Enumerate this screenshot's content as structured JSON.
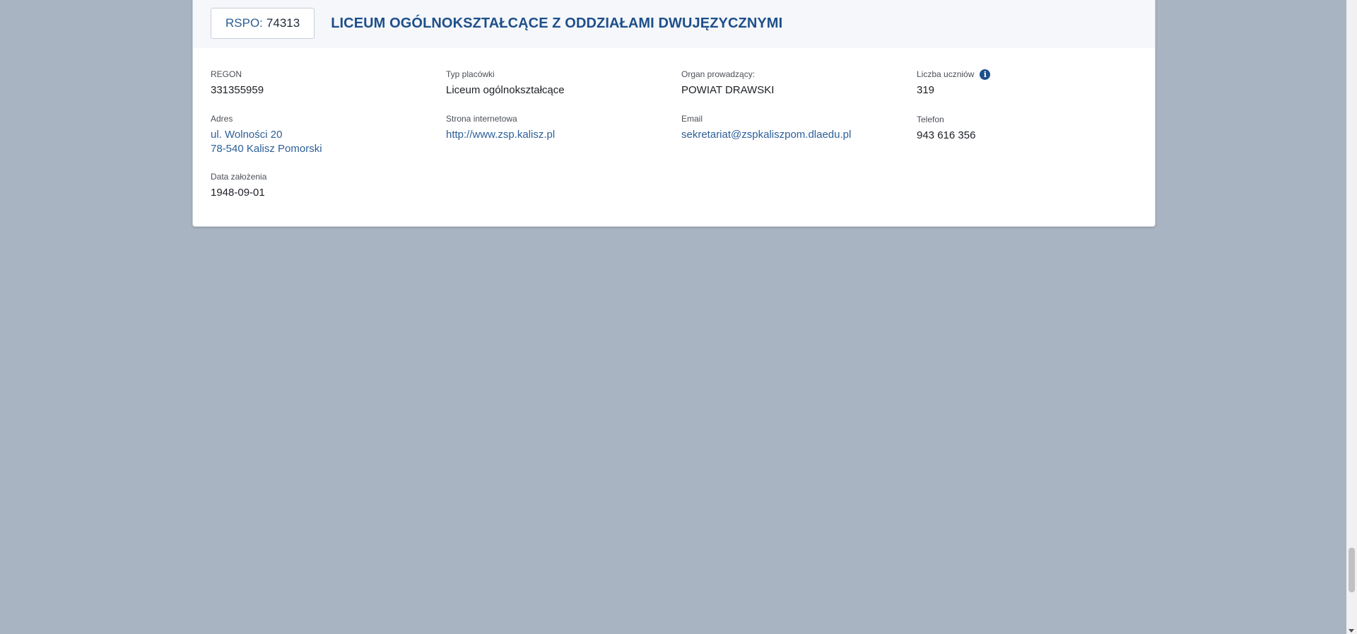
{
  "header": {
    "rspo_label": "RSPO:",
    "rspo_number": "74313",
    "school_name": "LICEUM OGÓLNOKSZTAŁCĄCE Z ODDZIAŁAMI DWUJĘZYCZNYMI"
  },
  "fields": {
    "regon": {
      "label": "REGON",
      "value": "331355959"
    },
    "typ": {
      "label": "Typ placówki",
      "value": "Liceum ogólnokształcące"
    },
    "organ": {
      "label": "Organ prowadzący:",
      "value": "POWIAT DRAWSKI"
    },
    "uczniowie": {
      "label": "Liczba uczniów",
      "value": "319"
    },
    "adres": {
      "label": "Adres",
      "line1": "ul. Wolności 20",
      "line2": "78-540 Kalisz Pomorski"
    },
    "strona": {
      "label": "Strona internetowa",
      "value": "http://www.zsp.kalisz.pl"
    },
    "email": {
      "label": "Email",
      "value": "sekretariat@zspkaliszpom.dlaedu.pl"
    },
    "telefon": {
      "label": "Telefon",
      "value": "943 616 356"
    },
    "data_zalozenia": {
      "label": "Data założenia",
      "value": "1948-09-01"
    }
  },
  "icons": {
    "info": "info-icon"
  },
  "colors": {
    "background": "#a9b4c2",
    "accent": "#1e4f8a",
    "link": "#2d5f9a"
  }
}
